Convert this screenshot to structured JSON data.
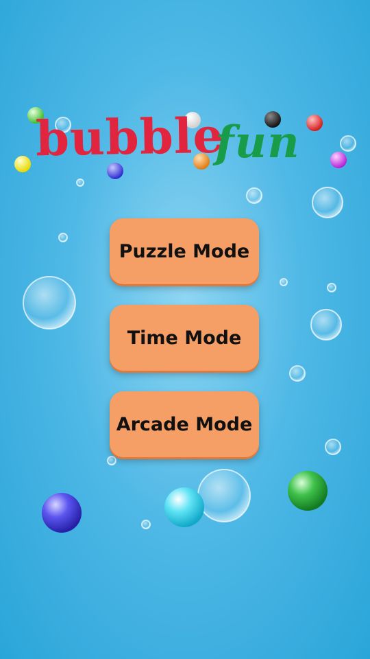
{
  "title": {
    "word1": "bubble",
    "word2": "fun",
    "colors": {
      "word1": "#e2253f",
      "word2": "#189c4a"
    }
  },
  "menu": {
    "puzzle_label": "Puzzle Mode",
    "time_label": "Time Mode",
    "arcade_label": "Arcade Mode",
    "button_color": "#f59e66"
  },
  "decorations": {
    "colored_balls": [
      "green",
      "white",
      "black",
      "red",
      "yellow",
      "blue",
      "orange",
      "purple",
      "blue",
      "cyan",
      "green"
    ],
    "background_color": "#2aa5d8"
  }
}
